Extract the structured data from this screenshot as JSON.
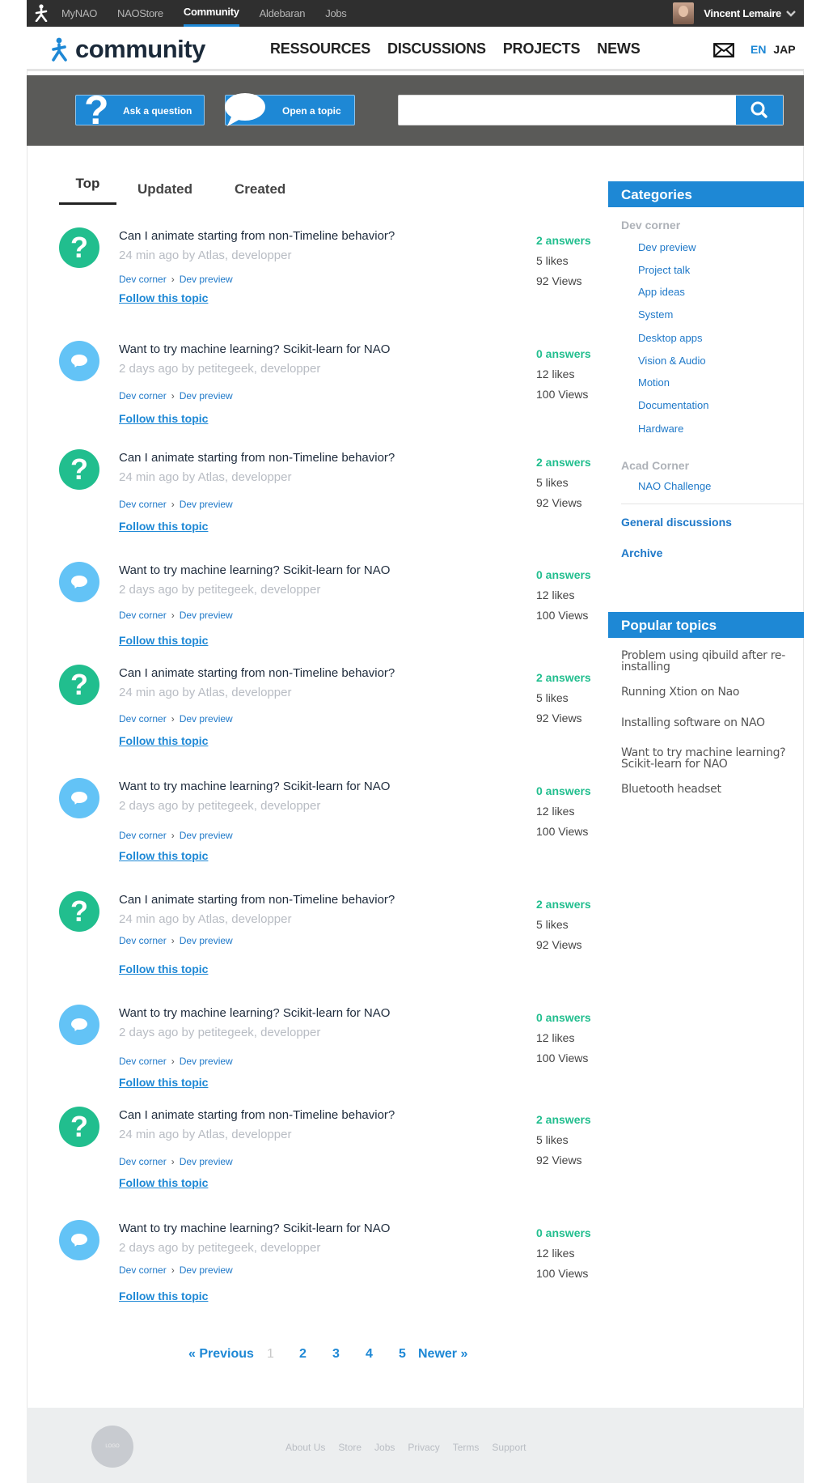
{
  "topbar": {
    "links": [
      "MyNAO",
      "NAOStore",
      "Community",
      "Aldebaran",
      "Jobs"
    ],
    "active": "Community",
    "user_name": "Vincent Lemaire"
  },
  "header": {
    "brand": "community",
    "nav": [
      "RESSOURCES",
      "DISCUSSIONS",
      "PROJECTS",
      "NEWS"
    ],
    "lang_en": "EN",
    "lang_jap": "JAP"
  },
  "actions": {
    "ask_label": "Ask a question",
    "open_label": "Open a topic",
    "search_placeholder": ""
  },
  "tabs": {
    "top": "Top",
    "updated": "Updated",
    "created": "Created"
  },
  "topics": [
    {
      "type": "question",
      "title": "Can I animate starting from non-Timeline behavior?",
      "meta": "24 min ago by Atlas, developper",
      "cat1": "Dev corner",
      "cat2": "Dev preview",
      "follow": "Follow this topic",
      "answers": "2 answers",
      "likes": "5 likes",
      "views": "92 Views"
    },
    {
      "type": "discussion",
      "title": "Want to try machine learning? Scikit-learn for NAO",
      "meta": "2 days ago by petitegeek, developper",
      "cat1": "Dev corner",
      "cat2": "Dev preview",
      "follow": "Follow this topic",
      "answers": "0 answers",
      "likes": "12 likes",
      "views": "100 Views"
    },
    {
      "type": "question",
      "title": "Can I animate starting from non-Timeline behavior?",
      "meta": "24 min ago by Atlas, developper",
      "cat1": "Dev corner",
      "cat2": "Dev preview",
      "follow": "Follow this topic",
      "answers": "2 answers",
      "likes": "5 likes",
      "views": "92 Views"
    },
    {
      "type": "discussion",
      "title": "Want to try machine learning? Scikit-learn for NAO",
      "meta": "2 days ago by petitegeek, developper",
      "cat1": "Dev corner",
      "cat2": "Dev preview",
      "follow": "Follow this topic",
      "answers": "0 answers",
      "likes": "12 likes",
      "views": "100 Views"
    },
    {
      "type": "question",
      "title": "Can I animate starting from non-Timeline behavior?",
      "meta": "24 min ago by Atlas, developper",
      "cat1": "Dev corner",
      "cat2": "Dev preview",
      "follow": "Follow this topic",
      "answers": "2 answers",
      "likes": "5 likes",
      "views": "92 Views"
    },
    {
      "type": "discussion",
      "title": "Want to try machine learning? Scikit-learn for NAO",
      "meta": "2 days ago by petitegeek, developper",
      "cat1": "Dev corner",
      "cat2": "Dev preview",
      "follow": "Follow this topic",
      "answers": "0 answers",
      "likes": "12 likes",
      "views": "100 Views"
    },
    {
      "type": "question",
      "title": "Can I animate starting from non-Timeline behavior?",
      "meta": "24 min ago by Atlas, developper",
      "cat1": "Dev corner",
      "cat2": "Dev preview",
      "follow": "Follow this topic",
      "answers": "2 answers",
      "likes": "5 likes",
      "views": "92 Views"
    },
    {
      "type": "discussion",
      "title": "Want to try machine learning? Scikit-learn for NAO",
      "meta": "2 days ago by petitegeek, developper",
      "cat1": "Dev corner",
      "cat2": "Dev preview",
      "follow": "Follow this topic",
      "answers": "0 answers",
      "likes": "12 likes",
      "views": "100 Views"
    },
    {
      "type": "question",
      "title": "Can I animate starting from non-Timeline behavior?",
      "meta": "24 min ago by Atlas, developper",
      "cat1": "Dev corner",
      "cat2": "Dev preview",
      "follow": "Follow this topic",
      "answers": "2 answers",
      "likes": "5 likes",
      "views": "92 Views"
    },
    {
      "type": "discussion",
      "title": "Want to try machine learning? Scikit-learn for NAO",
      "meta": "2 days ago by petitegeek, developper",
      "cat1": "Dev corner",
      "cat2": "Dev preview",
      "follow": "Follow this topic",
      "answers": "0 answers",
      "likes": "12 likes",
      "views": "100 Views"
    }
  ],
  "sidebar": {
    "categories_title": "Categories",
    "dev_corner": "Dev corner",
    "dev_items": [
      "Dev preview",
      "Project talk",
      "App ideas",
      "System",
      "Desktop apps",
      "Vision & Audio",
      "Motion",
      "Documentation",
      "Hardware"
    ],
    "acad_corner": "Acad Corner",
    "acad_items": [
      "NAO Challenge"
    ],
    "general": "General discussions",
    "archive": "Archive",
    "popular_title": "Popular topics",
    "popular": [
      "Problem using qibuild after re-installing",
      "Running Xtion on Nao",
      "Installing software on NAO",
      "Want to try machine learning? Scikit-learn for NAO",
      "Bluetooth headset"
    ]
  },
  "pagination": {
    "previous": "« Previous",
    "pages": [
      "1",
      "2",
      "3",
      "4",
      "5"
    ],
    "current": "1",
    "newer": "Newer »"
  },
  "footer": {
    "logo": "LOGO",
    "links": [
      "About Us",
      "Store",
      "Jobs",
      "Privacy",
      "Terms",
      "Support"
    ]
  },
  "colors": {
    "accent": "#1e88d5",
    "answers_green": "#21be8e",
    "discussion_blue": "#63c3f6",
    "band_gray": "#5a5a58"
  }
}
